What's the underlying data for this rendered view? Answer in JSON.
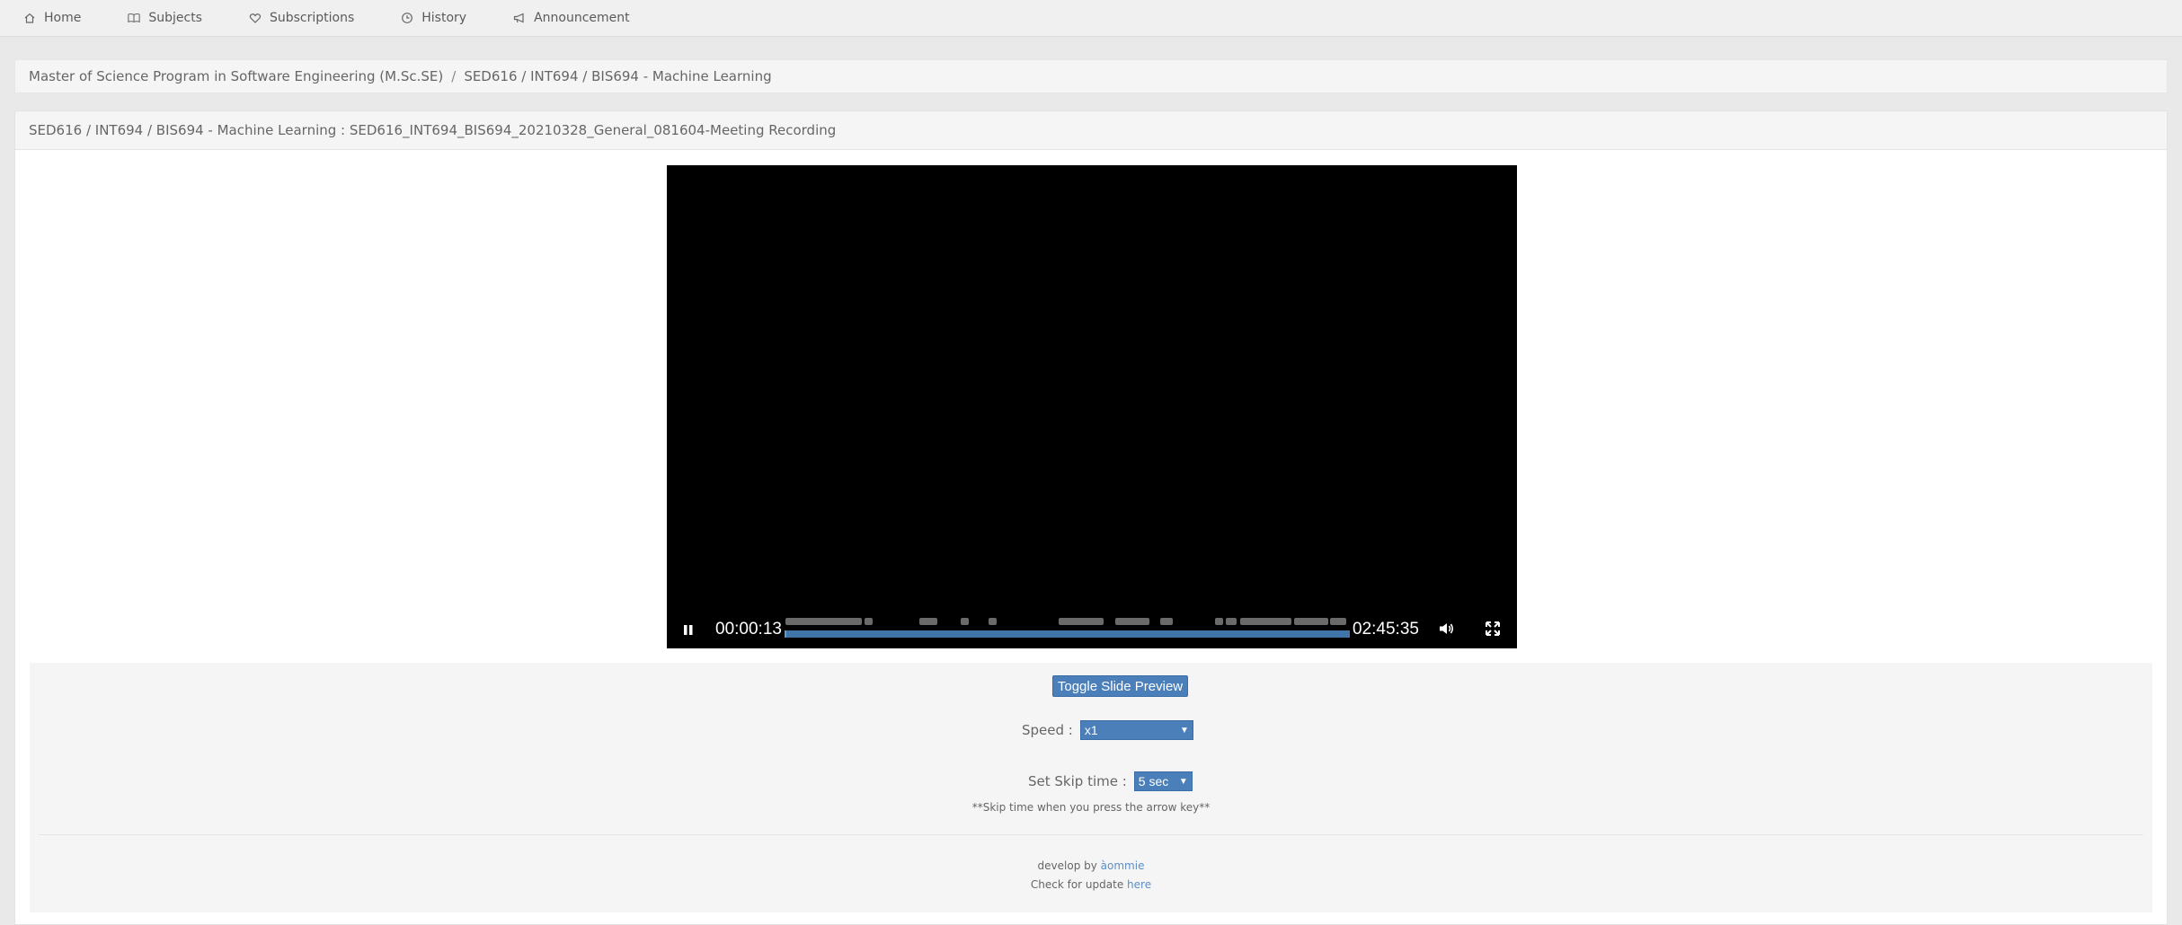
{
  "nav": {
    "items": [
      {
        "label": "Home",
        "icon": "home-icon"
      },
      {
        "label": "Subjects",
        "icon": "book-icon"
      },
      {
        "label": "Subscriptions",
        "icon": "heart-icon"
      },
      {
        "label": "History",
        "icon": "clock-icon"
      },
      {
        "label": "Announcement",
        "icon": "megaphone-icon"
      }
    ]
  },
  "breadcrumb": {
    "program": "Master of Science Program in Software Engineering (M.Sc.SE)",
    "separator": "/",
    "course": "SED616 / INT694 / BIS694 - Machine Learning"
  },
  "panel": {
    "title": "SED616 / INT694 / BIS694 - Machine Learning : SED616_INT694_BIS694_20210328_General_081604-Meeting Recording"
  },
  "player": {
    "current_time": "00:00:13",
    "duration": "02:45:35",
    "progress": 0.0013,
    "state": "playing"
  },
  "options": {
    "toggle_label": "Toggle Slide Preview",
    "speed_label": "Speed :",
    "speed_value": "x1",
    "skip_label": "Set Skip time :",
    "skip_value": "5 sec",
    "skip_note": "**Skip time when you press the arrow key**"
  },
  "footer": {
    "develop_by": "develop by",
    "author": "àommie",
    "check_update": "Check for update",
    "here": "here"
  },
  "colors": {
    "accent": "#4a7fba",
    "progress": "#5b9bd5"
  }
}
